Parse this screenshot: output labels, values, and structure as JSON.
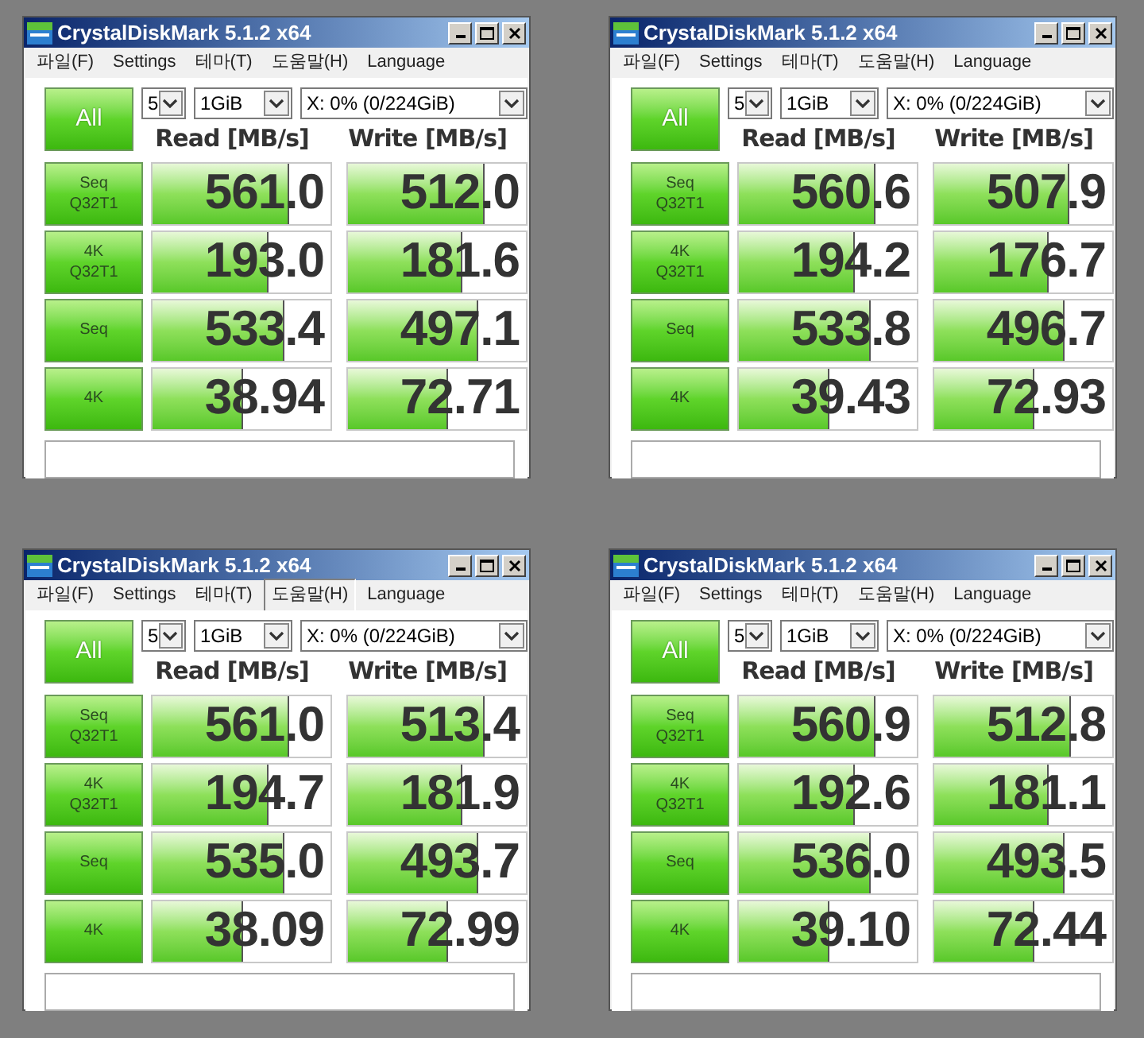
{
  "windows": [
    {
      "title": "CrystalDiskMark 5.1.2 x64",
      "menu": [
        {
          "label": "파일(F)",
          "selected": false
        },
        {
          "label": "Settings",
          "selected": false
        },
        {
          "label": "테마(T)",
          "selected": false
        },
        {
          "label": "도움말(H)",
          "selected": false
        },
        {
          "label": "Language",
          "selected": false
        }
      ],
      "count": "5",
      "size": "1GiB",
      "drive": "X: 0% (0/224GiB)",
      "all_label": "All",
      "headers": [
        "Read [MB/s]",
        "Write [MB/s]"
      ],
      "rows": [
        {
          "label": [
            "Seq",
            "Q32T1"
          ],
          "cells": [
            {
              "value": "561.0",
              "level": 0.77
            },
            {
              "value": "512.0",
              "level": 0.77
            }
          ]
        },
        {
          "label": [
            "4K",
            "Q32T1"
          ],
          "cells": [
            {
              "value": "193.0",
              "level": 0.65
            },
            {
              "value": "181.6",
              "level": 0.64
            }
          ]
        },
        {
          "label": [
            "Seq"
          ],
          "cells": [
            {
              "value": "533.4",
              "level": 0.74
            },
            {
              "value": "497.1",
              "level": 0.73
            }
          ]
        },
        {
          "label": [
            "4K"
          ],
          "cells": [
            {
              "value": "38.94",
              "level": 0.51
            },
            {
              "value": "72.71",
              "level": 0.56
            }
          ]
        }
      ]
    },
    {
      "title": "CrystalDiskMark 5.1.2 x64",
      "menu": [
        {
          "label": "파일(F)",
          "selected": false
        },
        {
          "label": "Settings",
          "selected": false
        },
        {
          "label": "테마(T)",
          "selected": false
        },
        {
          "label": "도움말(H)",
          "selected": false
        },
        {
          "label": "Language",
          "selected": false
        }
      ],
      "count": "5",
      "size": "1GiB",
      "drive": "X: 0% (0/224GiB)",
      "all_label": "All",
      "headers": [
        "Read [MB/s]",
        "Write [MB/s]"
      ],
      "rows": [
        {
          "label": [
            "Seq",
            "Q32T1"
          ],
          "cells": [
            {
              "value": "560.6",
              "level": 0.77
            },
            {
              "value": "507.9",
              "level": 0.76
            }
          ]
        },
        {
          "label": [
            "4K",
            "Q32T1"
          ],
          "cells": [
            {
              "value": "194.2",
              "level": 0.65
            },
            {
              "value": "176.7",
              "level": 0.64
            }
          ]
        },
        {
          "label": [
            "Seq"
          ],
          "cells": [
            {
              "value": "533.8",
              "level": 0.74
            },
            {
              "value": "496.7",
              "level": 0.73
            }
          ]
        },
        {
          "label": [
            "4K"
          ],
          "cells": [
            {
              "value": "39.43",
              "level": 0.51
            },
            {
              "value": "72.93",
              "level": 0.56
            }
          ]
        }
      ]
    },
    {
      "title": "CrystalDiskMark 5.1.2 x64",
      "menu": [
        {
          "label": "파일(F)",
          "selected": false
        },
        {
          "label": "Settings",
          "selected": false
        },
        {
          "label": "테마(T)",
          "selected": false
        },
        {
          "label": "도움말(H)",
          "selected": true
        },
        {
          "label": "Language",
          "selected": false
        }
      ],
      "count": "5",
      "size": "1GiB",
      "drive": "X: 0% (0/224GiB)",
      "all_label": "All",
      "headers": [
        "Read [MB/s]",
        "Write [MB/s]"
      ],
      "rows": [
        {
          "label": [
            "Seq",
            "Q32T1"
          ],
          "cells": [
            {
              "value": "561.0",
              "level": 0.77
            },
            {
              "value": "513.4",
              "level": 0.77
            }
          ]
        },
        {
          "label": [
            "4K",
            "Q32T1"
          ],
          "cells": [
            {
              "value": "194.7",
              "level": 0.65
            },
            {
              "value": "181.9",
              "level": 0.64
            }
          ]
        },
        {
          "label": [
            "Seq"
          ],
          "cells": [
            {
              "value": "535.0",
              "level": 0.74
            },
            {
              "value": "493.7",
              "level": 0.73
            }
          ]
        },
        {
          "label": [
            "4K"
          ],
          "cells": [
            {
              "value": "38.09",
              "level": 0.51
            },
            {
              "value": "72.99",
              "level": 0.56
            }
          ]
        }
      ]
    },
    {
      "title": "CrystalDiskMark 5.1.2 x64",
      "menu": [
        {
          "label": "파일(F)",
          "selected": false
        },
        {
          "label": "Settings",
          "selected": false
        },
        {
          "label": "테마(T)",
          "selected": false
        },
        {
          "label": "도움말(H)",
          "selected": false
        },
        {
          "label": "Language",
          "selected": false
        }
      ],
      "count": "5",
      "size": "1GiB",
      "drive": "X: 0% (0/224GiB)",
      "all_label": "All",
      "headers": [
        "Read [MB/s]",
        "Write [MB/s]"
      ],
      "rows": [
        {
          "label": [
            "Seq",
            "Q32T1"
          ],
          "cells": [
            {
              "value": "560.9",
              "level": 0.77
            },
            {
              "value": "512.8",
              "level": 0.77
            }
          ]
        },
        {
          "label": [
            "4K",
            "Q32T1"
          ],
          "cells": [
            {
              "value": "192.6",
              "level": 0.65
            },
            {
              "value": "181.1",
              "level": 0.64
            }
          ]
        },
        {
          "label": [
            "Seq"
          ],
          "cells": [
            {
              "value": "536.0",
              "level": 0.74
            },
            {
              "value": "493.5",
              "level": 0.73
            }
          ]
        },
        {
          "label": [
            "4K"
          ],
          "cells": [
            {
              "value": "39.10",
              "level": 0.51
            },
            {
              "value": "72.44",
              "level": 0.56
            }
          ]
        }
      ]
    }
  ]
}
